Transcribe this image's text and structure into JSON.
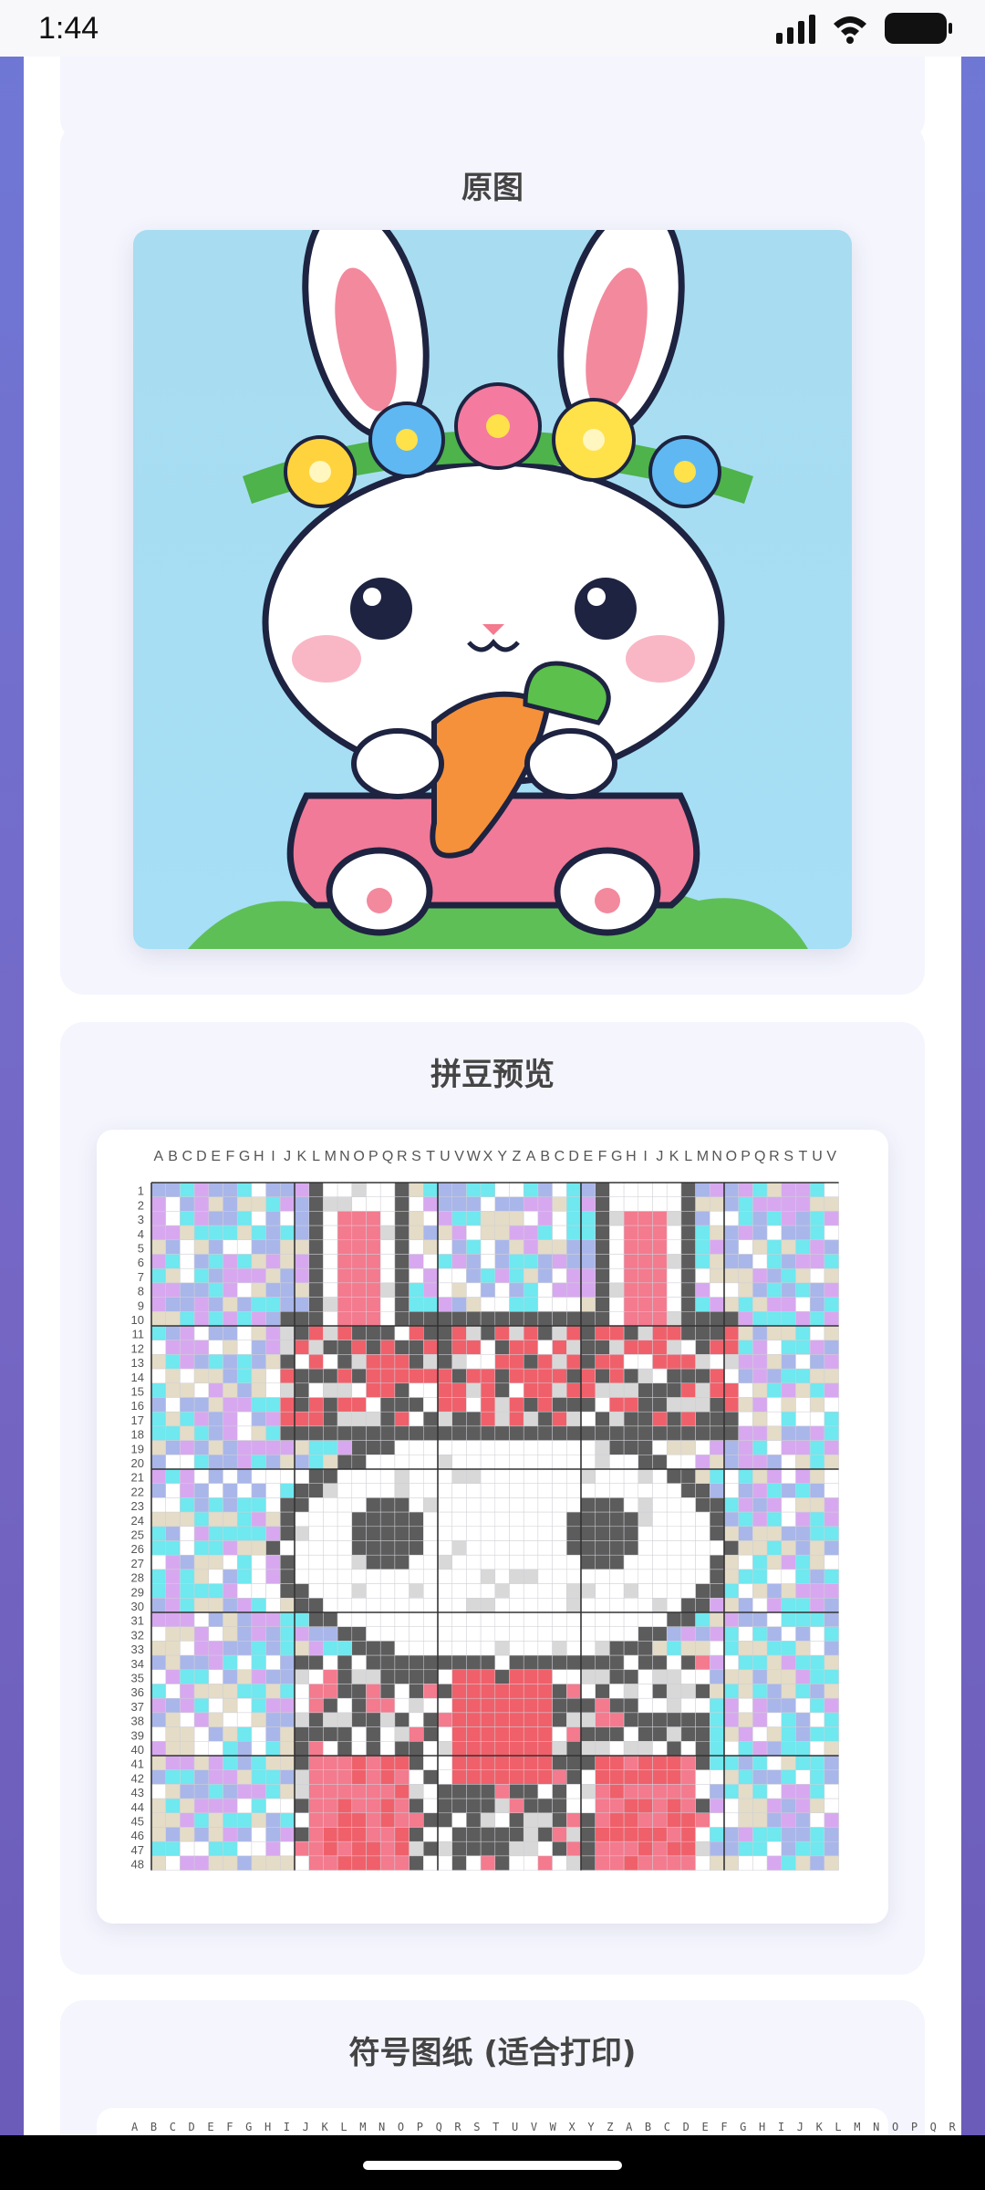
{
  "status_bar": {
    "time": "1:44",
    "icons": [
      "signal-icon",
      "wifi-icon",
      "battery-icon"
    ]
  },
  "sections": {
    "original": {
      "title": "原图",
      "image": "cartoon-bunny-with-flower-crown-and-carrot"
    },
    "preview": {
      "title": "拼豆预览",
      "column_labels": [
        "A",
        "B",
        "C",
        "D",
        "E",
        "F",
        "G",
        "H",
        "I",
        "J",
        "K",
        "L",
        "M",
        "N",
        "O",
        "P",
        "Q",
        "R",
        "S",
        "T",
        "U",
        "V",
        "W",
        "X",
        "Y",
        "Z",
        "A",
        "B",
        "C",
        "D",
        "E",
        "F",
        "G",
        "H",
        "I",
        "J",
        "K",
        "L",
        "M",
        "N",
        "O",
        "P",
        "Q",
        "R",
        "S",
        "T",
        "U",
        "V"
      ],
      "row_labels": [
        "1",
        "2",
        "3",
        "4",
        "5",
        "6",
        "7",
        "8",
        "9",
        "10",
        "11",
        "12",
        "13",
        "14",
        "15",
        "16",
        "17",
        "18",
        "19",
        "20",
        "21",
        "22",
        "23",
        "24",
        "25",
        "26",
        "27",
        "28",
        "29",
        "30",
        "31",
        "32",
        "33",
        "34",
        "35",
        "36",
        "37",
        "38",
        "39",
        "40",
        "41",
        "42",
        "43",
        "44",
        "45",
        "46",
        "47",
        "48"
      ],
      "bead_colors": {
        "background": [
          "#6fe8ef",
          "#d7a8ef",
          "#a9b6ea",
          "#e4dcc6",
          "#ffffff"
        ],
        "outline": "#5c5c5c",
        "white": "#ffffff",
        "pink": "#f47a8e",
        "red": "#f0606a",
        "light_gray": "#d8d8d8"
      }
    },
    "symbol": {
      "title": "符号图纸 (适合打印)",
      "column_labels": "A B C D E F G H I J K L M N O P Q R S T U V W X Y Z A B C D E F G H I J K L M N O P Q R S T U V"
    }
  }
}
